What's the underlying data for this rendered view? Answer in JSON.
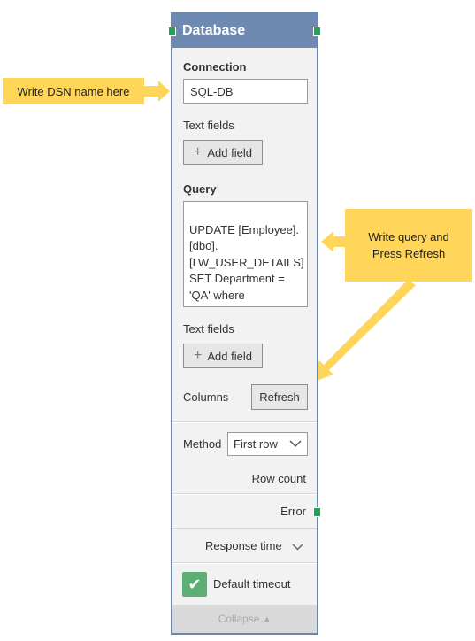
{
  "callouts": {
    "dsn": "Write DSN name here",
    "query_line1": "Write query and",
    "query_line2": "Press Refresh"
  },
  "panel": {
    "title": "Database",
    "connection_label": "Connection",
    "connection_value": "SQL-DB",
    "text_fields_label_1": "Text fields",
    "add_field_1": "Add field",
    "query_label": "Query",
    "query_value": "UPDATE [Employee].\n[dbo].\n[LW_USER_DETAILS]\nSET Department =\n'QA' where\nLastName = 'David';",
    "text_fields_label_2": "Text fields",
    "add_field_2": "Add field",
    "columns_label": "Columns",
    "refresh_button": "Refresh",
    "method_label": "Method",
    "method_value": "First row",
    "row_count_label": "Row count",
    "error_label": "Error",
    "response_time_label": "Response time",
    "default_timeout_label": "Default timeout",
    "default_timeout_checked": true,
    "collapse_label": "Collapse"
  },
  "colors": {
    "header": "#6e8ab3",
    "callout": "#ffd55a",
    "port": "#23a35a",
    "checkbox": "#5cae72"
  }
}
